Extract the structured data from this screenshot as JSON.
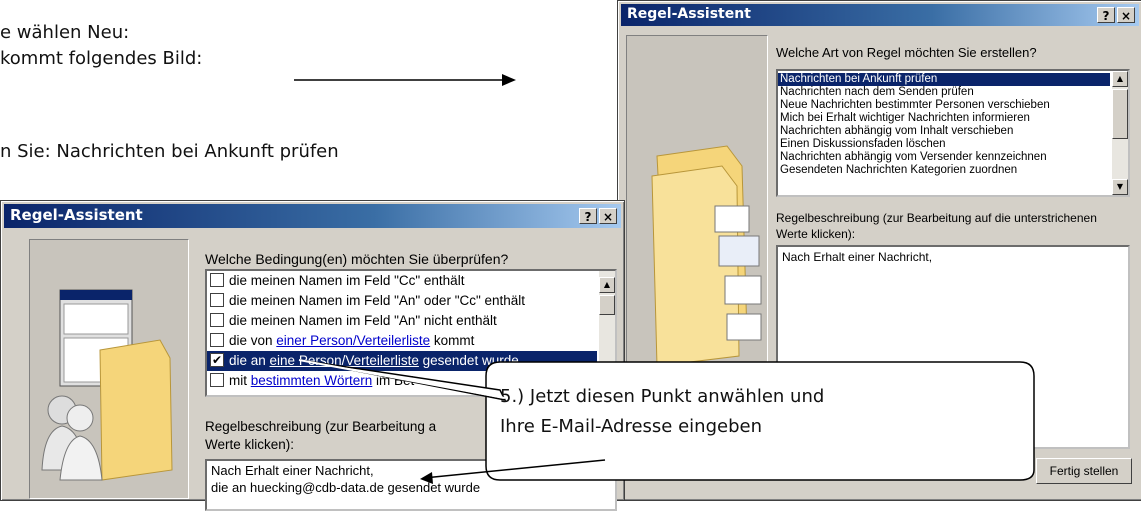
{
  "instructions": {
    "line1": "e wählen Neu:",
    "line2": "kommt folgendes Bild:",
    "line3": "n Sie: Nachrichten bei Ankunft prüfen"
  },
  "dialog_back": {
    "title": "Regel-Assistent",
    "help_btn": "?",
    "close_btn": "×",
    "question": "Welche Art von Regel möchten Sie erstellen?",
    "rules": [
      "Nachrichten bei Ankunft prüfen",
      "Nachrichten nach dem Senden prüfen",
      "Neue Nachrichten bestimmter Personen verschieben",
      "Mich bei Erhalt wichtiger Nachrichten informieren",
      "Nachrichten abhängig vom Inhalt verschieben",
      "Einen Diskussionsfaden löschen",
      "Nachrichten abhängig vom Versender kennzeichnen",
      "Gesendeten Nachrichten Kategorien zuordnen"
    ],
    "desc_label_1": "Regelbeschreibung (zur Bearbeitung auf die unterstrichenen",
    "desc_label_2": "Werte klicken):",
    "desc_text": "Nach Erhalt einer Nachricht,",
    "finish_btn": "Fertig stellen"
  },
  "dialog_front": {
    "title": "Regel-Assistent",
    "help_btn": "?",
    "close_btn": "×",
    "question": "Welche Bedingung(en) möchten Sie überprüfen?",
    "conditions": [
      {
        "pre": "die meinen Namen im Feld \"Cc\" enthält",
        "link": "",
        "post": "",
        "checked": ""
      },
      {
        "pre": "die meinen Namen im Feld \"An\" oder \"Cc\" enthält",
        "link": "",
        "post": "",
        "checked": ""
      },
      {
        "pre": "die meinen Namen im Feld \"An\" nicht enthält",
        "link": "",
        "post": "",
        "checked": ""
      },
      {
        "pre": "die von ",
        "link": "einer Person/Verteilerliste",
        "post": " kommt",
        "checked": ""
      },
      {
        "pre": "die an ",
        "link": "eine Person/Verteilerliste",
        "post": " gesendet wurde",
        "checked": "✔"
      },
      {
        "pre": "mit ",
        "link": "bestimmten Wörtern",
        "post": " im Bet",
        "checked": ""
      }
    ],
    "desc_label_1": "Regelbeschreibung (zur Bearbeitung a",
    "desc_label_2": "Werte klicken):",
    "desc_line1": "Nach Erhalt einer Nachricht,",
    "desc_line2": "die an huecking@cdb-data.de gesendet wurde"
  },
  "callout": {
    "line1": "5.) Jetzt diesen Punkt anwählen und",
    "line2": "Ihre E-Mail-Adresse eingeben"
  },
  "colors": {
    "title_start": "#0a246a",
    "title_end": "#a6caf0",
    "dialog_face": "#d4d0c8",
    "selection": "#0a246a",
    "link": "#0000cc"
  }
}
